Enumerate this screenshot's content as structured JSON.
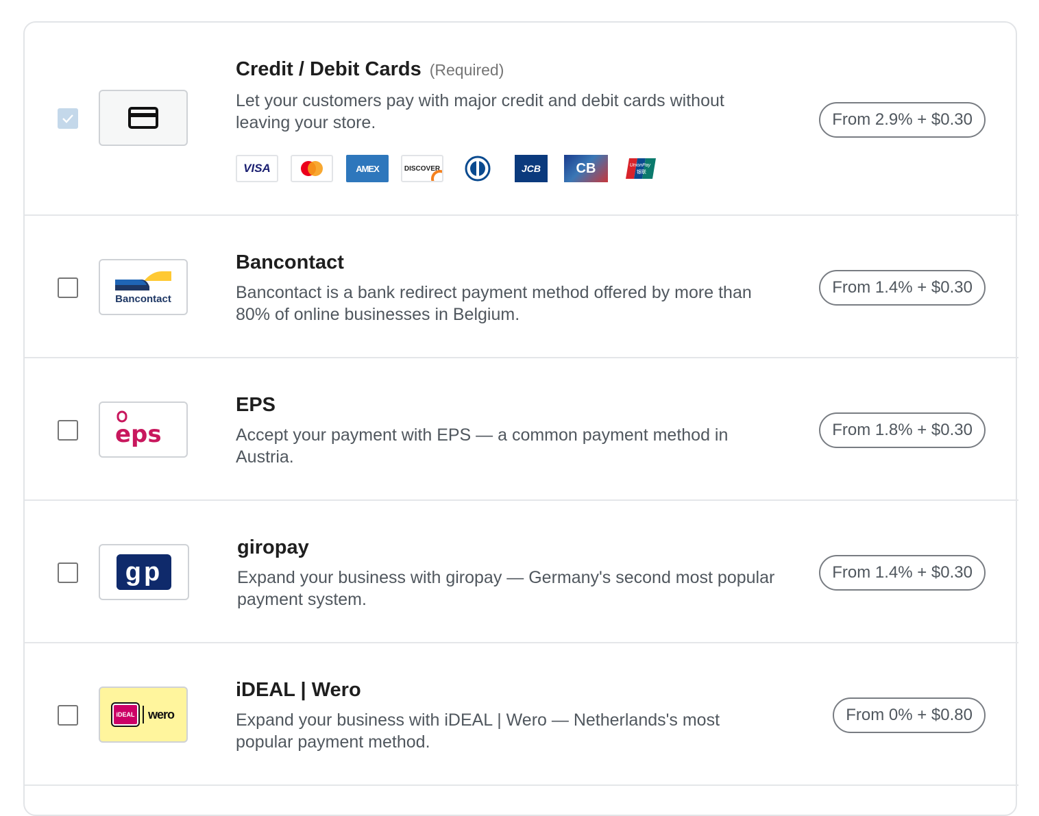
{
  "methods": [
    {
      "title": "Credit / Debit Cards",
      "tag": "(Required)",
      "description": "Let your customers pay with major credit and debit cards without leaving your store.",
      "price": "From 2.9% + $0.30",
      "checked": true,
      "logo": "credit-card-icon",
      "brands": [
        "VISA",
        "AMEX",
        "DISCOVER",
        "JCB",
        "CB",
        "UnionPay",
        "银联"
      ]
    },
    {
      "title": "Bancontact",
      "description": "Bancontact is a bank redirect payment method offered by more than 80% of online businesses in Belgium.",
      "price": "From 1.4% + $0.30",
      "checked": false,
      "logo_text": "Bancontact"
    },
    {
      "title": "EPS",
      "description": "Accept your payment with EPS — a common payment method in Austria.",
      "price": "From 1.8% + $0.30",
      "checked": false,
      "logo_text": "eps"
    },
    {
      "title": "giropay",
      "description": "Expand your business with giropay — Germany's second most popular payment system.",
      "price": "From 1.4% + $0.30",
      "checked": false,
      "logo_text": "gp"
    },
    {
      "title": "iDEAL | Wero",
      "description": "Expand your business with iDEAL | Wero — Netherlands's most popular payment method.",
      "price": "From 0% + $0.80",
      "checked": false,
      "logo_text_1": "iDEAL",
      "logo_text_2": "wero"
    }
  ],
  "colors": {
    "accent_checked": "#c4d8ea",
    "ideal_bg": "#fff59d",
    "giropay_navy": "#0f2a6b",
    "giropay_red": "#d8232a",
    "eps_pink": "#c8175d"
  }
}
